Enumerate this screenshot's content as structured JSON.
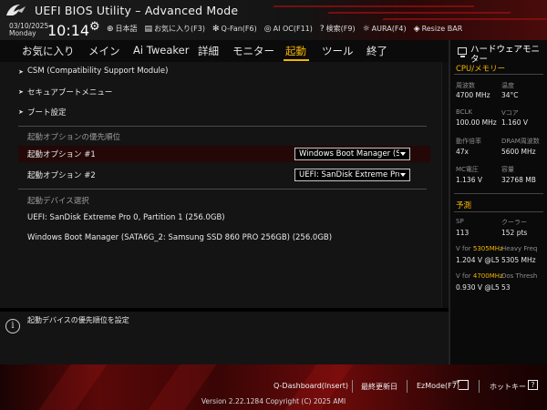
{
  "header": {
    "title": "UEFI BIOS Utility – Advanced Mode",
    "date": "03/10/2025",
    "weekday": "Monday",
    "time": "10:14",
    "tools": [
      {
        "label": "日本語",
        "icon": "globe-icon"
      },
      {
        "label": "お気に入り(F3)",
        "icon": "favorites-icon"
      },
      {
        "label": "Q-Fan(F6)",
        "icon": "fan-icon"
      },
      {
        "label": "AI OC(F11)",
        "icon": "ai-oc-icon"
      },
      {
        "label": "検索(F9)",
        "icon": "search-icon"
      },
      {
        "label": "AURA(F4)",
        "icon": "aura-icon"
      },
      {
        "label": "Resize BAR",
        "icon": "resize-bar-icon"
      }
    ]
  },
  "menu": {
    "items": [
      "お気に入り",
      "メイン",
      "Ai Tweaker",
      "詳細",
      "モニター",
      "起動",
      "ツール",
      "終了"
    ],
    "active": "起動"
  },
  "main": {
    "submenus": [
      "CSM (Compatibility Support Module)",
      "セキュアブートメニュー",
      "ブート設定"
    ],
    "priority_header": "起動オプションの優先順位",
    "options": [
      {
        "label": "起動オプション #1",
        "value": "Windows Boot Manager (SA"
      },
      {
        "label": "起動オプション #2",
        "value": "UEFI: SanDisk Extreme Pro"
      }
    ],
    "devices_header": "起動デバイス選択",
    "devices": [
      "UEFI: SanDisk Extreme Pro 0, Partition 1 (256.0GB)",
      "Windows Boot Manager (SATA6G_2: Samsung SSD 860 PRO 256GB) (256.0GB)"
    ]
  },
  "help": {
    "text": "起動デバイスの優先順位を設定"
  },
  "hw_monitor": {
    "title": "ハードウェアモニター",
    "cpu_memory_header": "CPU/メモリー",
    "stats": [
      {
        "label": "周波数",
        "value": "4700 MHz"
      },
      {
        "label": "温度",
        "value": "34°C"
      },
      {
        "label": "BCLK",
        "value": "100.00 MHz"
      },
      {
        "label": "Vコア",
        "value": "1.160 V"
      },
      {
        "label": "動作倍率",
        "value": "47x"
      },
      {
        "label": "DRAM周波数",
        "value": "5600 MHz"
      },
      {
        "label": "MC電圧",
        "value": "1.136 V"
      },
      {
        "label": "容量",
        "value": "32768 MB"
      }
    ],
    "prediction_header": "予測",
    "prediction": {
      "sp_label": "SP",
      "sp_value": "113",
      "cooler_label": "クーラー",
      "cooler_value": "152 pts",
      "v_for_a_prefix": "V for ",
      "v_for_a_freq": "5305MHz",
      "v_for_a_value": "1.204 V @L5",
      "heavy_freq_label": "Heavy Freq",
      "heavy_freq_value": "5305 MHz",
      "v_for_b_prefix": "V for ",
      "v_for_b_freq": "4700MHz",
      "v_for_b_value": "0.930 V @L5",
      "dos_thresh_label": "Dos Thresh",
      "dos_thresh_value": "53"
    }
  },
  "footer": {
    "qdashboard": "Q-Dashboard(Insert)",
    "last_modified": "最終更新日",
    "ezmode": "EzMode(F7)",
    "hotkeys": "ホットキー",
    "hotkey_glyph": "?",
    "copyright": "Version 2.22.1284 Copyright (C) 2025 AMI"
  },
  "colors": {
    "accent": "#f5b400",
    "brand_red": "#8b1010",
    "selection": "#240707"
  }
}
